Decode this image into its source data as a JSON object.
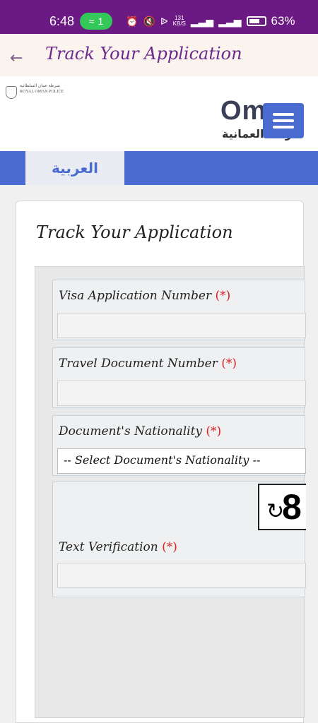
{
  "status_bar": {
    "time": "6:48",
    "wifi_count": "1",
    "speed": "131",
    "speed_unit": "KB/S",
    "battery": "63%"
  },
  "app_header": {
    "title": "Track Your Application"
  },
  "site_header": {
    "emblem_text_line1": "شرطة عمان السلطانية",
    "emblem_text_line2": "ROYAL OMAN POLICE",
    "logo_text": "Oman",
    "logo_arabic": "شرطة العمانية"
  },
  "nav": {
    "language_tab": "العربية"
  },
  "panel": {
    "title": "Track Your Application"
  },
  "form": {
    "visa_label": "Visa Application Number",
    "travel_label": "Travel Document Number",
    "nationality_label": "Document's Nationality",
    "nationality_selected": "-- Select Document's Nationality --",
    "verification_label": "Text Verification",
    "required_marker": "(*)",
    "captcha_text": "8"
  }
}
